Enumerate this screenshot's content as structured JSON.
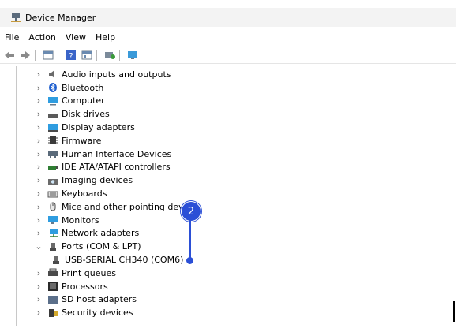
{
  "window": {
    "title": "Device Manager"
  },
  "menu": [
    "File",
    "Action",
    "View",
    "Help"
  ],
  "toolbar": {
    "icons": [
      "back-icon",
      "forward-icon",
      "show-hide-console-tree-icon",
      "help-icon",
      "properties-icon",
      "scan-hardware-icon",
      "monitor-icon"
    ]
  },
  "tree": {
    "items": [
      {
        "label": "Audio inputs and outputs",
        "icon": "speaker-icon",
        "state": "collapsed"
      },
      {
        "label": "Bluetooth",
        "icon": "bluetooth-icon",
        "state": "collapsed"
      },
      {
        "label": "Computer",
        "icon": "computer-icon",
        "state": "collapsed"
      },
      {
        "label": "Disk drives",
        "icon": "disk-drive-icon",
        "state": "collapsed"
      },
      {
        "label": "Display adapters",
        "icon": "display-adapter-icon",
        "state": "collapsed"
      },
      {
        "label": "Firmware",
        "icon": "firmware-icon",
        "state": "collapsed"
      },
      {
        "label": "Human Interface Devices",
        "icon": "hid-icon",
        "state": "collapsed"
      },
      {
        "label": "IDE ATA/ATAPI controllers",
        "icon": "ide-controller-icon",
        "state": "collapsed"
      },
      {
        "label": "Imaging devices",
        "icon": "camera-icon",
        "state": "collapsed"
      },
      {
        "label": "Keyboards",
        "icon": "keyboard-icon",
        "state": "collapsed"
      },
      {
        "label": "Mice and other pointing devic",
        "icon": "mouse-icon",
        "state": "collapsed"
      },
      {
        "label": "Monitors",
        "icon": "monitor-icon",
        "state": "collapsed"
      },
      {
        "label": "Network adapters",
        "icon": "network-icon",
        "state": "collapsed"
      },
      {
        "label": "Ports (COM & LPT)",
        "icon": "port-icon",
        "state": "expanded"
      },
      {
        "label": "USB-SERIAL CH340 (COM6)",
        "icon": "port-icon",
        "state": "child"
      },
      {
        "label": "Print queues",
        "icon": "printer-icon",
        "state": "collapsed"
      },
      {
        "label": "Processors",
        "icon": "processor-icon",
        "state": "collapsed"
      },
      {
        "label": "SD host adapters",
        "icon": "sd-adapter-icon",
        "state": "collapsed"
      },
      {
        "label": "Security devices",
        "icon": "security-icon",
        "state": "collapsed"
      }
    ]
  },
  "callout": {
    "number": "2",
    "color": "#2b4fd6"
  }
}
